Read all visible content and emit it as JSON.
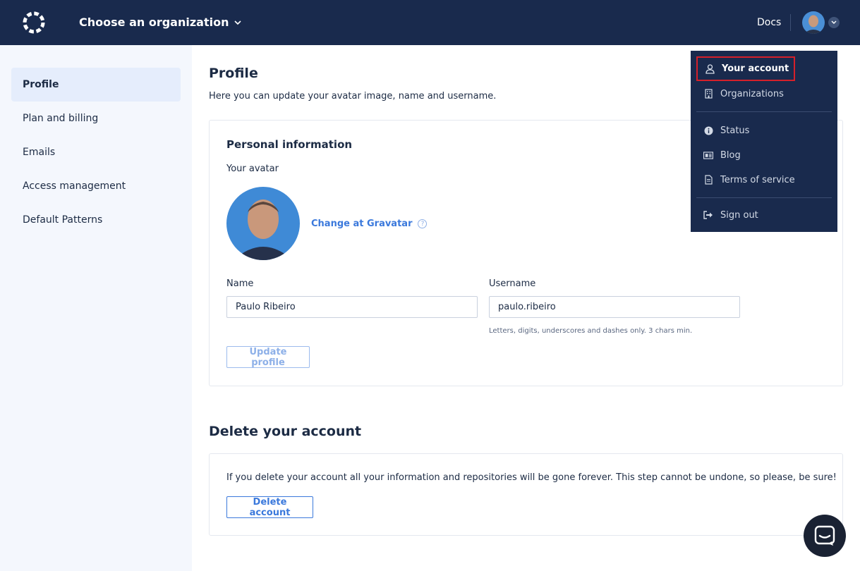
{
  "header": {
    "org_selector": "Choose an organization",
    "docs": "Docs"
  },
  "sidebar": {
    "items": [
      {
        "label": "Profile",
        "active": true
      },
      {
        "label": "Plan and billing"
      },
      {
        "label": "Emails"
      },
      {
        "label": "Access management"
      },
      {
        "label": "Default Patterns"
      }
    ]
  },
  "main": {
    "title": "Profile",
    "subtitle": "Here you can update your avatar image, name and username.",
    "personal": {
      "title": "Personal information",
      "avatar_label": "Your avatar",
      "gravatar_link": "Change at Gravatar",
      "help_glyph": "?",
      "name_label": "Name",
      "name_value": "Paulo Ribeiro",
      "username_label": "Username",
      "username_value": "paulo.ribeiro",
      "username_hint": "Letters, digits, underscores and dashes only. 3 chars min.",
      "update_button": "Update profile"
    },
    "delete": {
      "title": "Delete your account",
      "text": "If you delete your account all your information and repositories will be gone forever. This step cannot be undone, so please, be sure!",
      "button": "Delete account"
    }
  },
  "user_menu": {
    "items": [
      {
        "label": "Your account",
        "icon": "user-icon"
      },
      {
        "label": "Organizations",
        "icon": "building-icon"
      },
      {
        "label": "Status",
        "icon": "info-icon"
      },
      {
        "label": "Blog",
        "icon": "newspaper-icon"
      },
      {
        "label": "Terms of service",
        "icon": "document-icon"
      },
      {
        "label": "Sign out",
        "icon": "sign-out-icon"
      }
    ]
  },
  "colors": {
    "navy": "#192a4d",
    "accent": "#3b79dc",
    "highlight": "#d5202a"
  }
}
